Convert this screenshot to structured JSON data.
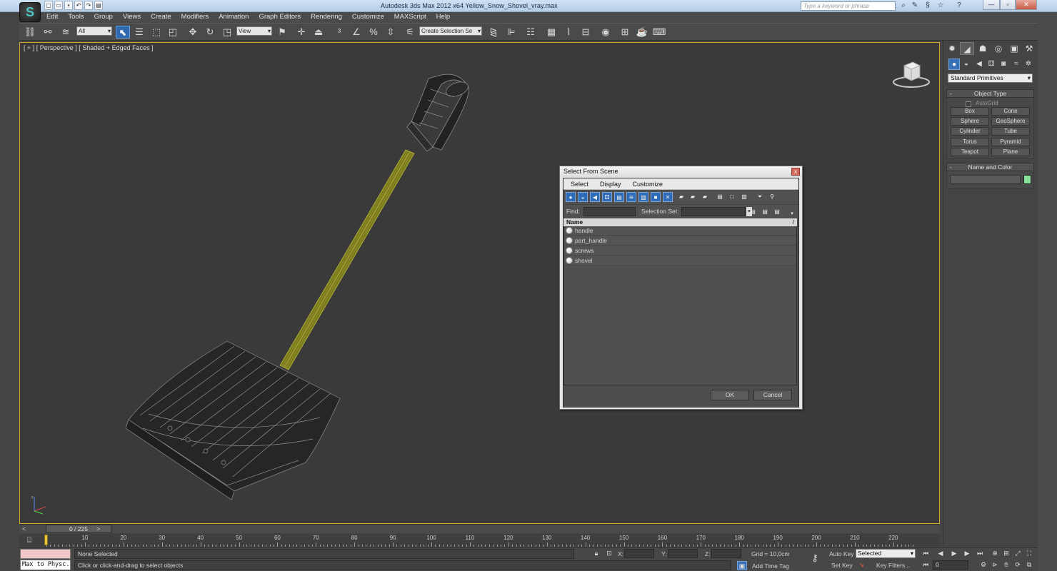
{
  "titlebar": {
    "app_title": "Autodesk 3ds Max  2012 x64      Yellow_Snow_Shovel_vray.max",
    "search_placeholder": "Type a keyword or phrase",
    "minimize": "—",
    "maximize": "▫",
    "close": "✕"
  },
  "logo": {
    "glyph": "S"
  },
  "menubar": {
    "items": [
      "Edit",
      "Tools",
      "Group",
      "Views",
      "Create",
      "Modifiers",
      "Animation",
      "Graph Editors",
      "Rendering",
      "Customize",
      "MAXScript",
      "Help"
    ]
  },
  "toolbar": {
    "selection_filter": "All",
    "reference_coord": "View",
    "named_selection": "Create Selection Se"
  },
  "viewport": {
    "label": "[ + ] [ Perspective ] [ Shaded + Edged Faces ]",
    "accent_color": "#d6a629"
  },
  "command_panel": {
    "category_dropdown": "Standard Primitives",
    "object_type": {
      "title": "Object Type",
      "autogrid": "AutoGrid",
      "buttons": [
        "Box",
        "Cone",
        "Sphere",
        "GeoSphere",
        "Cylinder",
        "Tube",
        "Torus",
        "Pyramid",
        "Teapot",
        "Plane"
      ]
    },
    "name_and_color": {
      "title": "Name and Color",
      "color": "#88e09a"
    }
  },
  "dialog": {
    "title": "Select From Scene",
    "close": "x",
    "menu": [
      "Select",
      "Display",
      "Customize"
    ],
    "find_label": "Find:",
    "selection_set_label": "Selection Set:",
    "list_header": "Name",
    "list_sort": "/",
    "objects": [
      "handle",
      "part_handle",
      "screws",
      "shovel"
    ],
    "ok": "OK",
    "cancel": "Cancel"
  },
  "timeline": {
    "frame_display": "0 / 225",
    "prev": "<",
    "next": ">",
    "ruler_labels": [
      "10",
      "20",
      "30",
      "40",
      "50",
      "60",
      "70",
      "80",
      "90",
      "100",
      "110",
      "120",
      "130",
      "140",
      "150",
      "160",
      "170",
      "180",
      "190",
      "200",
      "210",
      "220"
    ]
  },
  "statusbar": {
    "maxscript_text": "Max to Physc.",
    "status": "None Selected",
    "prompt": "Click or click-and-drag to select objects",
    "x_label": "X:",
    "y_label": "Y:",
    "z_label": "Z:",
    "grid": "Grid = 10,0cm",
    "add_time_tag": "Add Time Tag",
    "auto_key": "Auto Key",
    "set_key": "Set Key",
    "selected": "Selected",
    "key_filters": "Key Filters...",
    "current_frame": "0"
  }
}
